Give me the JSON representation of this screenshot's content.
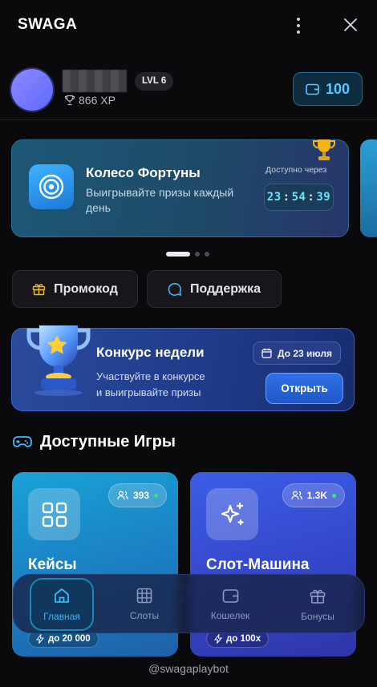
{
  "header": {
    "title": "SWAGA",
    "menu_icon": "kebab-menu-icon",
    "close_icon": "close-icon"
  },
  "profile": {
    "xp": "866 XP",
    "level": "LVL 6",
    "balance": "100"
  },
  "carousel": {
    "title": "Колесо Фортуны",
    "subtitle": "Выигрывайте призы каждый день",
    "available_label": "Доступно через",
    "timer": {
      "h": "23",
      "m": "54",
      "s": "39"
    },
    "active_index": 0,
    "slides": 3
  },
  "actions": {
    "promo": "Промокод",
    "support": "Поддержка"
  },
  "contest": {
    "title": "Конкурс недели",
    "subtitle_line1": "Участвуйте в конкурсе",
    "subtitle_line2": "и выигрывайте призы",
    "date": "До 23 июля",
    "open_label": "Открыть"
  },
  "games_section": {
    "title": "Доступные Игры",
    "cards": [
      {
        "name": "Кейсы",
        "online": "393",
        "prize": "до 20 000",
        "icon": "grid-icon",
        "color": "#1aa2d6"
      },
      {
        "name": "Слот-Машина",
        "online": "1.3K",
        "prize": "до 100х",
        "icon": "sparkles-icon",
        "color": "#3b5ee6"
      }
    ]
  },
  "nav": {
    "items": [
      {
        "label": "Главная",
        "icon": "home-icon",
        "active": true
      },
      {
        "label": "Слоты",
        "icon": "slots-grid-icon",
        "active": false
      },
      {
        "label": "Кошелек",
        "icon": "wallet-icon",
        "active": false
      },
      {
        "label": "Бонусы",
        "icon": "gift-icon",
        "active": false
      }
    ]
  },
  "footer": {
    "handle": "@swagaplaybot"
  },
  "colors": {
    "accent": "#35b9ff",
    "online": "#3ee37f",
    "balance": "#58c6ff"
  }
}
